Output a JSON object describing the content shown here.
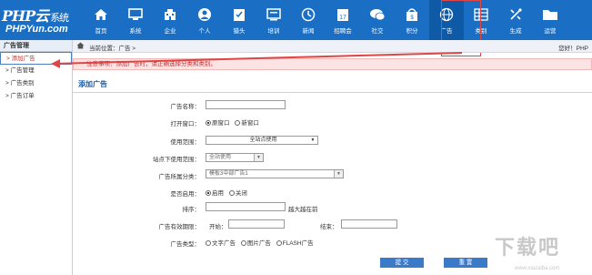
{
  "app": {
    "logo_main": "PHP云",
    "logo_sub": "系统",
    "logo_domain": "PHPYun.com"
  },
  "nav": [
    {
      "label": "首页",
      "icon": "home-icon"
    },
    {
      "label": "系统",
      "icon": "monitor-icon"
    },
    {
      "label": "企业",
      "icon": "building-icon"
    },
    {
      "label": "个人",
      "icon": "user-icon"
    },
    {
      "label": "猎头",
      "icon": "clipboard-icon"
    },
    {
      "label": "培训",
      "icon": "training-icon"
    },
    {
      "label": "新闻",
      "icon": "news-icon"
    },
    {
      "label": "招聘会",
      "icon": "calendar-icon"
    },
    {
      "label": "社交",
      "icon": "chat-icon"
    },
    {
      "label": "积分",
      "icon": "points-icon"
    },
    {
      "label": "广告",
      "icon": "globe-icon"
    },
    {
      "label": "类别",
      "icon": "category-icon"
    },
    {
      "label": "生成",
      "icon": "generate-icon"
    },
    {
      "label": "运营",
      "icon": "folder-icon"
    }
  ],
  "sidebar": {
    "title": "广告管理",
    "items": [
      {
        "label": "> 添加广告"
      },
      {
        "label": "> 广告管理"
      },
      {
        "label": "> 广告类别"
      },
      {
        "label": "> 广告订单"
      }
    ]
  },
  "breadcrumb": {
    "text": "当前位置：广告 >",
    "user": "您好！PHP"
  },
  "notice": "注意事项：添加广告时，请正确选择分类和类别。",
  "panel": {
    "title": "添加广告"
  },
  "form": {
    "name_label": "广告名称：",
    "name_value": "",
    "window_label": "打开窗口：",
    "window_opt1": "原窗口",
    "window_opt2": "新窗口",
    "scope_label": "使用范围：",
    "scope_value": "全站点使用",
    "site_label": "站点下使用范围：",
    "site_value": "全站使用",
    "category_label": "广告所属分类：",
    "category_value": "模板3中部广告1",
    "enable_label": "是否启用：",
    "enable_opt1": "启用",
    "enable_opt2": "关闭",
    "order_label": "排序：",
    "order_note": "越大越在前",
    "period_label": "广告有效期限：",
    "start_label": "开始：",
    "end_label": "结束：",
    "type_label": "广告类型：",
    "type_opt1": "文字广告",
    "type_opt2": "图片广告",
    "type_opt3": "FLASH广告"
  },
  "buttons": {
    "submit": "提 交",
    "reset": "重 置"
  },
  "watermark": {
    "main": "下载吧",
    "sub": "www.xiazaiba.com"
  },
  "colors": {
    "topbar": "#1a6fc4",
    "accent": "#3b79c9",
    "notice_bg": "#fde4e4",
    "annotation": "#e04545"
  }
}
